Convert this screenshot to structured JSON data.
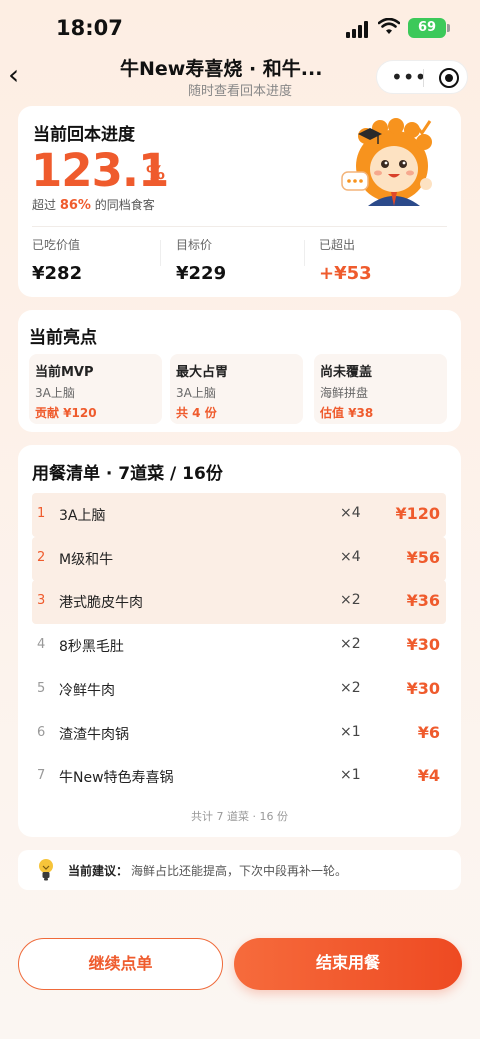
{
  "status_bar": {
    "time": "18:07",
    "battery": "69"
  },
  "nav": {
    "title": "牛New寿喜烧 · 和牛...",
    "subtitle": "随时查看回本进度",
    "back_label": "‹",
    "more_label": "•••"
  },
  "progress": {
    "title": "当前回本进度",
    "percent": "123.1",
    "unit": "%",
    "beat_prefix": "超过",
    "beat_value": "86%",
    "beat_suffix": "的同档食客",
    "stats": [
      {
        "label": "已吃价值",
        "value": "¥282"
      },
      {
        "label": "目标价",
        "value": "¥229"
      },
      {
        "label": "已超出",
        "value": "+¥53"
      }
    ]
  },
  "highlights": {
    "title": "当前亮点",
    "items": [
      {
        "title": "当前MVP",
        "dish": "3A上脑",
        "extra": "贡献 ¥120"
      },
      {
        "title": "最大占胃",
        "dish": "3A上脑",
        "extra": "共 4 份"
      },
      {
        "title": "尚未覆盖",
        "dish": "海鲜拼盘",
        "extra": "估值 ¥38"
      }
    ]
  },
  "order": {
    "title": "用餐清单 · 7道菜 / 16份",
    "items": [
      {
        "rank": "1",
        "name": "3A上脑",
        "qty": "×4",
        "price": "¥120"
      },
      {
        "rank": "2",
        "name": "M级和牛",
        "qty": "×4",
        "price": "¥56"
      },
      {
        "rank": "3",
        "name": "港式脆皮牛肉",
        "qty": "×2",
        "price": "¥36"
      },
      {
        "rank": "4",
        "name": "8秒黑毛肚",
        "qty": "×2",
        "price": "¥30"
      },
      {
        "rank": "5",
        "name": "冷鲜牛肉",
        "qty": "×2",
        "price": "¥30"
      },
      {
        "rank": "6",
        "name": "渣渣牛肉锅",
        "qty": "×1",
        "price": "¥6"
      },
      {
        "rank": "7",
        "name": "牛New特色寿喜锅",
        "qty": "×1",
        "price": "¥4"
      }
    ],
    "total": "共计 7 道菜 · 16 份"
  },
  "tip": {
    "label": "当前建议：",
    "text": "海鲜占比还能提高，下次中段再补一轮。"
  },
  "buttons": {
    "continue": "继续点单",
    "end": "结束用餐"
  },
  "colors": {
    "accent": "#ef5b2d",
    "battery": "#3cc95a"
  },
  "icons": [
    "signal-icon",
    "wifi-icon",
    "battery-icon",
    "back-icon",
    "more-icon",
    "target-icon",
    "mascot-icon",
    "bulb-icon"
  ]
}
